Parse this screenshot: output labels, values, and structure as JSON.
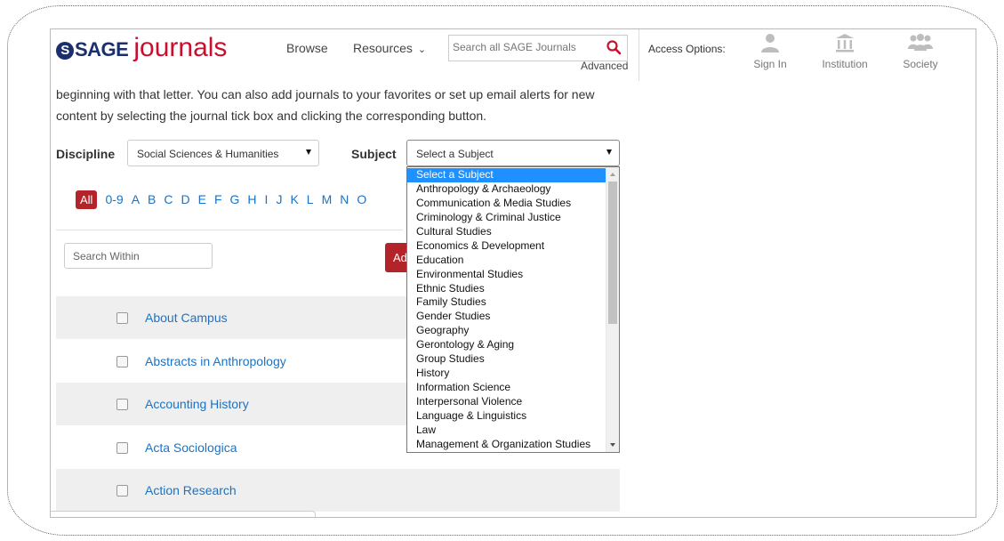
{
  "header": {
    "logo_mark": "SAGE",
    "logo_s": "S",
    "logo_word": "journals",
    "nav": {
      "browse": "Browse",
      "resources": "Resources"
    },
    "search": {
      "placeholder": "Search all SAGE Journals",
      "advanced": "Advanced"
    },
    "access": {
      "label": "Access Options:",
      "sign_in": "Sign In",
      "institution": "Institution",
      "society": "Society"
    }
  },
  "intro": {
    "line1": "beginning with that letter. You can also add journals to your favorites or set up email alerts for new",
    "line2": "content by selecting the journal tick box and clicking the corresponding button."
  },
  "filters": {
    "discipline_label": "Discipline",
    "discipline_value": "Social Sciences & Humanities",
    "subject_label": "Subject",
    "subject_value": "Select a Subject"
  },
  "alphabet": {
    "all": "All",
    "letters": [
      "0-9",
      "A",
      "B",
      "C",
      "D",
      "E",
      "F",
      "G",
      "H",
      "I",
      "J",
      "K",
      "L",
      "M",
      "N",
      "O"
    ]
  },
  "search_within": {
    "placeholder": "Search Within"
  },
  "add_button": {
    "label": "Ad"
  },
  "journals": [
    "About Campus",
    "Abstracts in Anthropology",
    "Accounting History",
    "Acta Sociologica",
    "Action Research"
  ],
  "subject_options": [
    "Select a Subject",
    "Anthropology & Archaeology",
    "Communication & Media Studies",
    "Criminology & Criminal Justice",
    "Cultural Studies",
    "Economics & Development",
    "Education",
    "Environmental Studies",
    "Ethnic Studies",
    "Family Studies",
    "Gender Studies",
    "Geography",
    "Gerontology & Aging",
    "Group Studies",
    "History",
    "Information Science",
    "Interpersonal Violence",
    "Language & Linguistics",
    "Law",
    "Management & Organization Studies"
  ],
  "subject_selected_index": 0,
  "colors": {
    "brand_red": "#c8102e",
    "brand_navy": "#1b2f6e",
    "link_blue": "#1a73c6",
    "active_red": "#b3232a",
    "selection_blue": "#1e90ff"
  }
}
